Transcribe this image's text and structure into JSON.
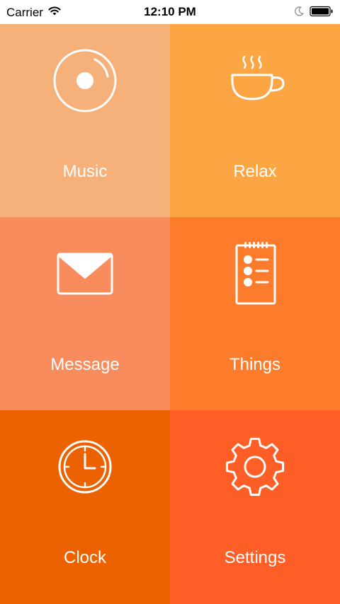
{
  "status_bar": {
    "carrier": "Carrier",
    "time": "12:10 PM",
    "icons": [
      "wifi-icon",
      "moon-icon",
      "battery-icon"
    ]
  },
  "tiles": [
    {
      "label": "Music",
      "icon": "music-disc-icon",
      "color": "#F6B17A"
    },
    {
      "label": "Relax",
      "icon": "coffee-cup-icon",
      "color": "#FBA643"
    },
    {
      "label": "Message",
      "icon": "envelope-icon",
      "color": "#F88C5C"
    },
    {
      "label": "Things",
      "icon": "checklist-icon",
      "color": "#FD7C2B"
    },
    {
      "label": "Clock",
      "icon": "clock-icon",
      "color": "#EC6200"
    },
    {
      "label": "Settings",
      "icon": "gear-icon",
      "color": "#FF5E26"
    }
  ]
}
